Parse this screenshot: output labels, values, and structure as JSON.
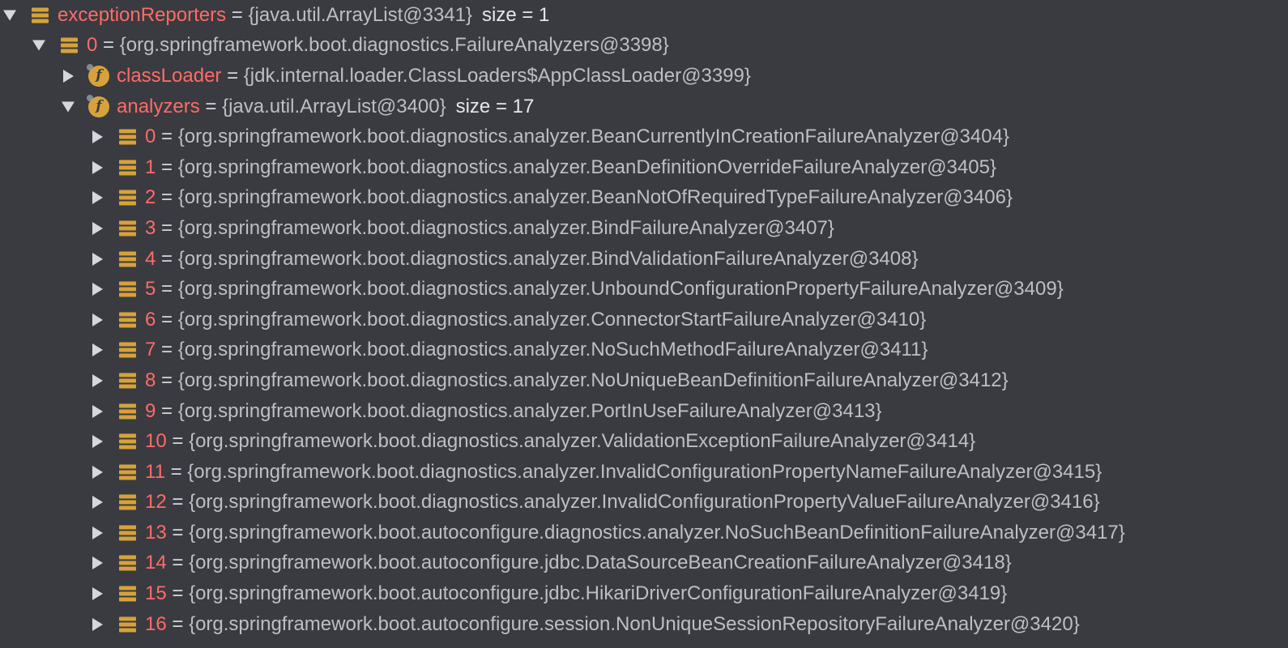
{
  "tree": {
    "rows": [
      {
        "level": 0,
        "expanded": true,
        "icon": "list-icon",
        "name": "exceptionReporters",
        "value": "{java.util.ArrayList@3341}",
        "size": "size = 1"
      },
      {
        "level": 1,
        "expanded": true,
        "icon": "list-icon",
        "name": "0",
        "value": "{org.springframework.boot.diagnostics.FailureAnalyzers@3398}",
        "size": ""
      },
      {
        "level": 2,
        "expanded": false,
        "icon": "field-icon",
        "name": "classLoader",
        "value": "{jdk.internal.loader.ClassLoaders$AppClassLoader@3399}",
        "size": ""
      },
      {
        "level": 2,
        "expanded": true,
        "icon": "field-icon",
        "name": "analyzers",
        "value": "{java.util.ArrayList@3400}",
        "size": "size = 17"
      },
      {
        "level": 3,
        "expanded": false,
        "icon": "list-icon",
        "name": "0",
        "value": "{org.springframework.boot.diagnostics.analyzer.BeanCurrentlyInCreationFailureAnalyzer@3404}",
        "size": ""
      },
      {
        "level": 3,
        "expanded": false,
        "icon": "list-icon",
        "name": "1",
        "value": "{org.springframework.boot.diagnostics.analyzer.BeanDefinitionOverrideFailureAnalyzer@3405}",
        "size": ""
      },
      {
        "level": 3,
        "expanded": false,
        "icon": "list-icon",
        "name": "2",
        "value": "{org.springframework.boot.diagnostics.analyzer.BeanNotOfRequiredTypeFailureAnalyzer@3406}",
        "size": ""
      },
      {
        "level": 3,
        "expanded": false,
        "icon": "list-icon",
        "name": "3",
        "value": "{org.springframework.boot.diagnostics.analyzer.BindFailureAnalyzer@3407}",
        "size": ""
      },
      {
        "level": 3,
        "expanded": false,
        "icon": "list-icon",
        "name": "4",
        "value": "{org.springframework.boot.diagnostics.analyzer.BindValidationFailureAnalyzer@3408}",
        "size": ""
      },
      {
        "level": 3,
        "expanded": false,
        "icon": "list-icon",
        "name": "5",
        "value": "{org.springframework.boot.diagnostics.analyzer.UnboundConfigurationPropertyFailureAnalyzer@3409}",
        "size": ""
      },
      {
        "level": 3,
        "expanded": false,
        "icon": "list-icon",
        "name": "6",
        "value": "{org.springframework.boot.diagnostics.analyzer.ConnectorStartFailureAnalyzer@3410}",
        "size": ""
      },
      {
        "level": 3,
        "expanded": false,
        "icon": "list-icon",
        "name": "7",
        "value": "{org.springframework.boot.diagnostics.analyzer.NoSuchMethodFailureAnalyzer@3411}",
        "size": ""
      },
      {
        "level": 3,
        "expanded": false,
        "icon": "list-icon",
        "name": "8",
        "value": "{org.springframework.boot.diagnostics.analyzer.NoUniqueBeanDefinitionFailureAnalyzer@3412}",
        "size": ""
      },
      {
        "level": 3,
        "expanded": false,
        "icon": "list-icon",
        "name": "9",
        "value": "{org.springframework.boot.diagnostics.analyzer.PortInUseFailureAnalyzer@3413}",
        "size": ""
      },
      {
        "level": 3,
        "expanded": false,
        "icon": "list-icon",
        "name": "10",
        "value": "{org.springframework.boot.diagnostics.analyzer.ValidationExceptionFailureAnalyzer@3414}",
        "size": ""
      },
      {
        "level": 3,
        "expanded": false,
        "icon": "list-icon",
        "name": "11",
        "value": "{org.springframework.boot.diagnostics.analyzer.InvalidConfigurationPropertyNameFailureAnalyzer@3415}",
        "size": ""
      },
      {
        "level": 3,
        "expanded": false,
        "icon": "list-icon",
        "name": "12",
        "value": "{org.springframework.boot.diagnostics.analyzer.InvalidConfigurationPropertyValueFailureAnalyzer@3416}",
        "size": ""
      },
      {
        "level": 3,
        "expanded": false,
        "icon": "list-icon",
        "name": "13",
        "value": "{org.springframework.boot.autoconfigure.diagnostics.analyzer.NoSuchBeanDefinitionFailureAnalyzer@3417}",
        "size": ""
      },
      {
        "level": 3,
        "expanded": false,
        "icon": "list-icon",
        "name": "14",
        "value": "{org.springframework.boot.autoconfigure.jdbc.DataSourceBeanCreationFailureAnalyzer@3418}",
        "size": ""
      },
      {
        "level": 3,
        "expanded": false,
        "icon": "list-icon",
        "name": "15",
        "value": "{org.springframework.boot.autoconfigure.jdbc.HikariDriverConfigurationFailureAnalyzer@3419}",
        "size": ""
      },
      {
        "level": 3,
        "expanded": false,
        "icon": "list-icon",
        "name": "16",
        "value": "{org.springframework.boot.autoconfigure.session.NonUniqueSessionRepositoryFailureAnalyzer@3420}",
        "size": ""
      }
    ]
  },
  "colors": {
    "background": "#393b40",
    "name": "#ff6b68",
    "value": "#bdbfc4",
    "icon": "#d7a23a"
  }
}
